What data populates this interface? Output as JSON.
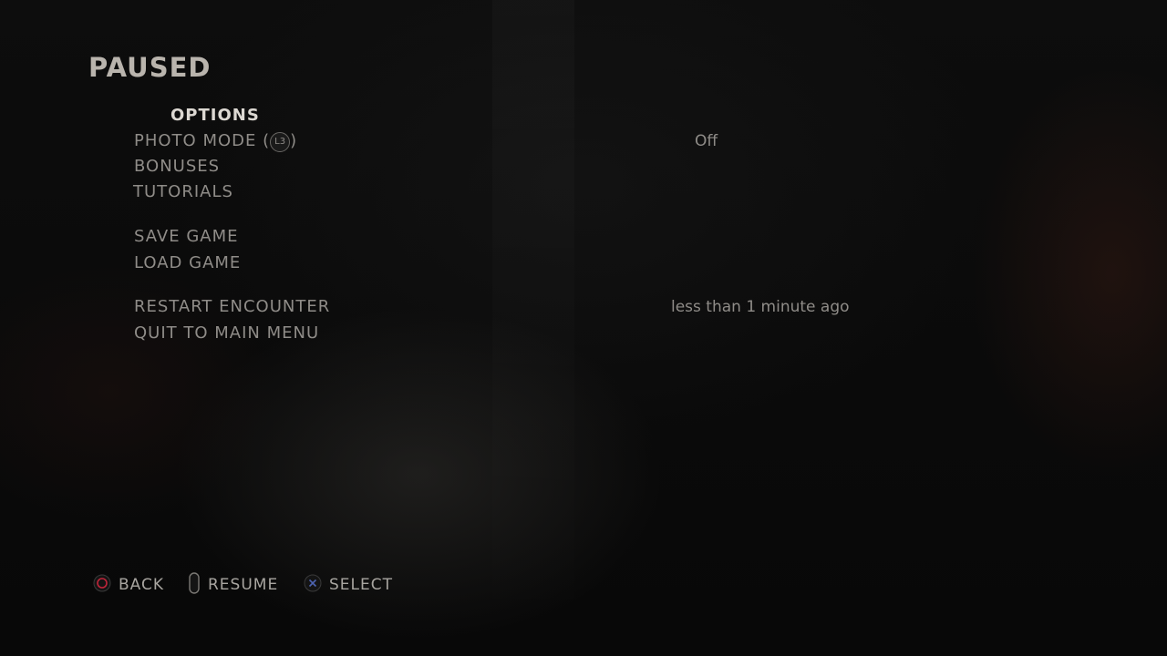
{
  "title": "PAUSED",
  "menu": {
    "options": "OPTIONS",
    "photo_mode": {
      "label": "PHOTO MODE (",
      "badge": "L3",
      "suffix": ")",
      "value": "Off"
    },
    "bonuses": "BONUSES",
    "tutorials": "TUTORIALS",
    "save_game": "SAVE GAME",
    "load_game": "LOAD GAME",
    "restart_encounter": {
      "label": "RESTART ENCOUNTER",
      "value": "less than 1 minute ago"
    },
    "quit": "QUIT TO MAIN MENU"
  },
  "hints": {
    "back": {
      "label": "BACK",
      "icon": "circle-button-icon"
    },
    "resume": {
      "label": "RESUME",
      "icon": "options-button-icon"
    },
    "select": {
      "label": "SELECT",
      "icon": "cross-button-icon"
    }
  },
  "colors": {
    "circle_button": "#c0253a",
    "cross_button": "#4d63b0",
    "selected_text": "#dcd8d2",
    "menu_text": "#8f8c88"
  }
}
